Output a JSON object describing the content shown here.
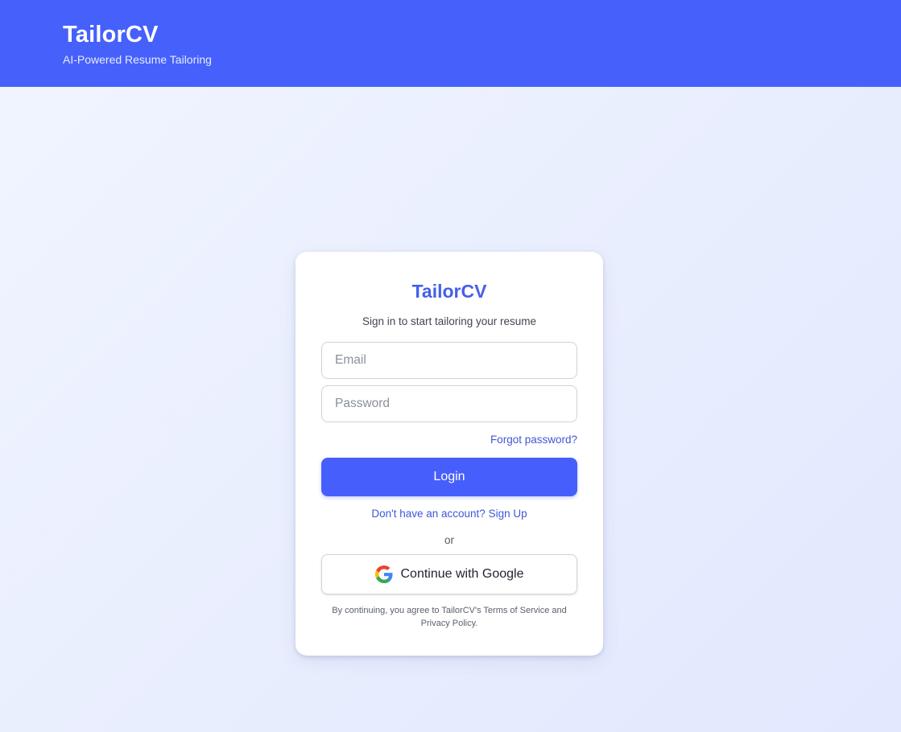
{
  "header": {
    "brand": "TailorCV",
    "tagline": "AI-Powered Resume Tailoring",
    "background": "#4660fc"
  },
  "login_card": {
    "title": "TailorCV",
    "subtitle": "Sign in to start tailoring your resume",
    "email": {
      "value": "",
      "placeholder": "Email"
    },
    "password": {
      "value": "",
      "placeholder": "Password"
    },
    "forgot_password": "Forgot password?",
    "login_label": "Login",
    "signup_prompt": "Don't have an account? Sign Up",
    "divider": "or",
    "google_label": "Continue with Google",
    "google_icon": "google-icon",
    "legal_line1": "By continuing, you agree to TailorCV's Terms of Service and",
    "legal_line2": "Privacy Policy."
  },
  "colors": {
    "accent": "#4660fc",
    "link": "#3f57d9",
    "title": "#4660e8"
  }
}
